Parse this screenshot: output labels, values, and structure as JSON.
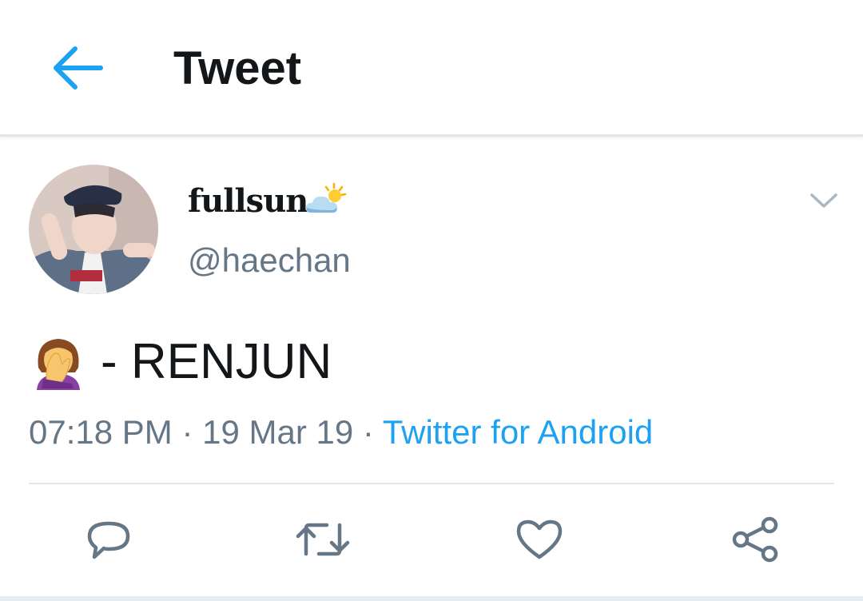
{
  "header": {
    "title": "Tweet",
    "back_icon": "arrow-left-icon"
  },
  "tweet": {
    "author": {
      "display_name": "fullsun",
      "name_emoji": "sun-behind-cloud-emoji",
      "handle": "@haechan",
      "avatar": "profile-photo"
    },
    "text_emoji": "face-palm-woman-emoji",
    "text": "- RENJUN",
    "timestamp": "07:18 PM",
    "separator": " · ",
    "date": "19 Mar 19",
    "source": "Twitter for Android",
    "menu_icon": "chevron-down-icon"
  },
  "actions": [
    {
      "name": "reply",
      "icon": "comment-icon"
    },
    {
      "name": "retweet",
      "icon": "retweet-icon"
    },
    {
      "name": "like",
      "icon": "heart-icon"
    },
    {
      "name": "share",
      "icon": "share-icon"
    }
  ],
  "colors": {
    "accent": "#1da1f2",
    "text_primary": "#14171a",
    "text_secondary": "#657786",
    "icon_gray": "#657786",
    "divider": "#e1e8ed"
  }
}
